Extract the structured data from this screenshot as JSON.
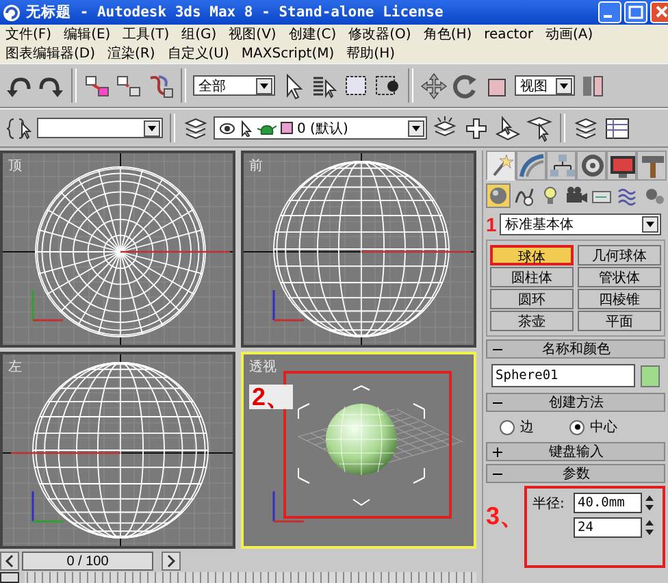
{
  "window": {
    "title": "无标题 - Autodesk 3ds Max 8  - Stand-alone License"
  },
  "menu_bar": {
    "items": [
      "文件(F)",
      "编辑(E)",
      "工具(T)",
      "组(G)",
      "视图(V)",
      "创建(C)",
      "修改器(O)",
      "角色(H)",
      "reactor",
      "动画(A)"
    ]
  },
  "menu_bar_continued": {
    "items": [
      "图表编辑器(D)",
      "渲染(R)",
      "自定义(U)",
      "MAXScript(M)",
      "帮助(H)"
    ]
  },
  "main_toolbar": {
    "selection_filter": "全部",
    "reference_coordinate_system": "视图"
  },
  "layer_toolbar": {
    "current_layer": "0 (默认)"
  },
  "viewports": [
    {
      "kind": "top",
      "label": "顶",
      "selected": false
    },
    {
      "kind": "front",
      "label": "前",
      "selected": false
    },
    {
      "kind": "left",
      "label": "左",
      "selected": false
    },
    {
      "kind": "perspective",
      "label": "透视",
      "selected": true,
      "annotation": "2、"
    }
  ],
  "time_slider": {
    "frame": "0 / 100",
    "level": 0
  },
  "command_panel": {
    "tabs": [
      {
        "kind": "create",
        "selected": true
      },
      {
        "kind": "modify",
        "selected": false
      },
      {
        "kind": "hierarchy",
        "selected": false
      },
      {
        "kind": "motion",
        "selected": false
      },
      {
        "kind": "display",
        "selected": false
      },
      {
        "kind": "utilities",
        "selected": false
      }
    ],
    "subtabs": [
      {
        "kind": "geometry",
        "selected": true
      },
      {
        "kind": "shapes",
        "selected": false
      },
      {
        "kind": "lights",
        "selected": false
      },
      {
        "kind": "cameras",
        "selected": false
      },
      {
        "kind": "helpers",
        "selected": false
      },
      {
        "kind": "space_warps",
        "selected": false
      },
      {
        "kind": "systems",
        "selected": false
      }
    ],
    "category_annotation": "1",
    "category": "标准基本体",
    "object_types": [
      {
        "label": "球体",
        "selected": true
      },
      {
        "label": "几何球体",
        "selected": false
      },
      {
        "label": "圆柱体",
        "selected": false
      },
      {
        "label": "管状体",
        "selected": false
      },
      {
        "label": "圆环",
        "selected": false
      },
      {
        "label": "四棱锥",
        "selected": false
      },
      {
        "label": "茶壶",
        "selected": false
      },
      {
        "label": "平面",
        "selected": false
      }
    ],
    "rollouts": [
      {
        "kind": "name_color",
        "title": "名称和颜色",
        "expanded": true,
        "name": "Sphere01",
        "color": "#9edb8a"
      },
      {
        "kind": "creation_method",
        "title": "创建方法",
        "expanded": true,
        "options": [
          {
            "label": "边",
            "selected": false
          },
          {
            "label": "中心",
            "selected": true
          }
        ]
      },
      {
        "kind": "keyboard_entry",
        "title": "键盘输入",
        "expanded": false
      },
      {
        "kind": "parameters",
        "title": "参数",
        "expanded": true,
        "annotation": "3、",
        "fields": [
          {
            "label": "半径:",
            "value": "40.0mm"
          },
          {
            "value": "24"
          }
        ]
      }
    ]
  }
}
